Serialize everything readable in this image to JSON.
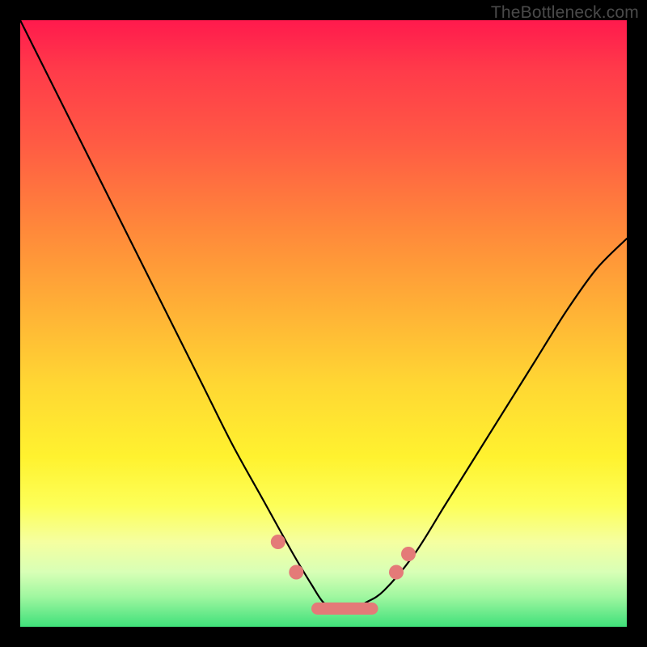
{
  "watermark": "TheBottleneck.com",
  "chart_data": {
    "type": "line",
    "title": "",
    "xlabel": "",
    "ylabel": "",
    "xlim": [
      0,
      100
    ],
    "ylim": [
      0,
      100
    ],
    "grid": false,
    "legend": false,
    "background_gradient": {
      "direction": "vertical",
      "stops": [
        {
          "pos": 0,
          "color": "#ff1a4d"
        },
        {
          "pos": 35,
          "color": "#ff8a3a"
        },
        {
          "pos": 72,
          "color": "#fff22f"
        },
        {
          "pos": 100,
          "color": "#3fe07a"
        }
      ]
    },
    "series": [
      {
        "name": "bottleneck-curve",
        "x": [
          0,
          5,
          10,
          15,
          20,
          25,
          30,
          35,
          40,
          45,
          48,
          50,
          52,
          55,
          57,
          60,
          65,
          70,
          75,
          80,
          85,
          90,
          95,
          100
        ],
        "y": [
          100,
          90,
          80,
          70,
          60,
          50,
          40,
          30,
          21,
          12,
          7,
          4,
          3,
          3,
          4,
          6,
          12,
          20,
          28,
          36,
          44,
          52,
          59,
          64
        ]
      }
    ],
    "markers": [
      {
        "name": "left-upper-dot",
        "x": 42.5,
        "y": 14
      },
      {
        "name": "left-lower-dot",
        "x": 45.5,
        "y": 9
      },
      {
        "name": "right-lower-dot",
        "x": 62,
        "y": 9
      },
      {
        "name": "right-upper-dot",
        "x": 64,
        "y": 12
      },
      {
        "name": "flat-segment",
        "x_from": 49,
        "x_to": 58,
        "y": 3
      }
    ]
  }
}
